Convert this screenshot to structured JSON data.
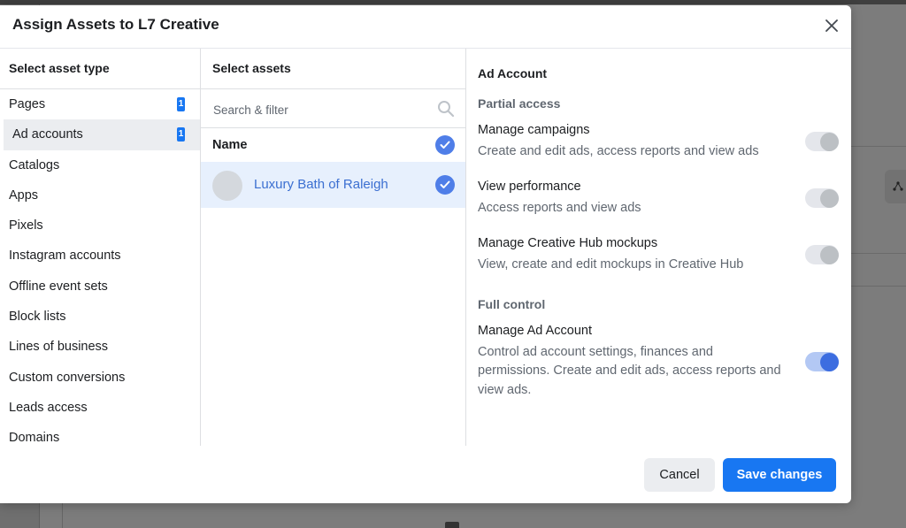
{
  "modal": {
    "title": "Assign Assets to L7 Creative",
    "close_icon": "close-icon"
  },
  "asset_types": {
    "header": "Select asset type",
    "items": [
      {
        "label": "Pages",
        "badge": "1"
      },
      {
        "label": "Ad accounts",
        "badge": "1",
        "selected": true
      },
      {
        "label": "Catalogs"
      },
      {
        "label": "Apps"
      },
      {
        "label": "Pixels"
      },
      {
        "label": "Instagram accounts"
      },
      {
        "label": "Offline event sets"
      },
      {
        "label": "Block lists"
      },
      {
        "label": "Lines of business"
      },
      {
        "label": "Custom conversions"
      },
      {
        "label": "Leads access"
      },
      {
        "label": "Domains"
      }
    ]
  },
  "assets": {
    "header": "Select assets",
    "search_placeholder": "Search & filter",
    "name_header": "Name",
    "items": [
      {
        "name": "Luxury Bath of Raleigh",
        "checked": true
      }
    ]
  },
  "permissions": {
    "title": "Ad Account",
    "partial_label": "Partial access",
    "full_label": "Full control",
    "items": [
      {
        "name": "Manage campaigns",
        "desc": "Create and edit ads, access reports and view ads",
        "enabled": false
      },
      {
        "name": "View performance",
        "desc": "Access reports and view ads",
        "enabled": false
      },
      {
        "name": "Manage Creative Hub mockups",
        "desc": "View, create and edit mockups in Creative Hub",
        "enabled": false
      },
      {
        "name": "Manage Ad Account",
        "desc_lines": [
          "Control ad account settings, finances and",
          "permissions. Create and edit ads, access reports and",
          "view ads."
        ],
        "enabled": true
      }
    ]
  },
  "footer": {
    "cancel_label": "Cancel",
    "save_label": "Save changes"
  },
  "background": {
    "pixels_label": "Pixels"
  },
  "colors": {
    "primary": "#1877f2",
    "toggle_on": "#3c6de0",
    "selected_row": "#e7f0fd"
  }
}
